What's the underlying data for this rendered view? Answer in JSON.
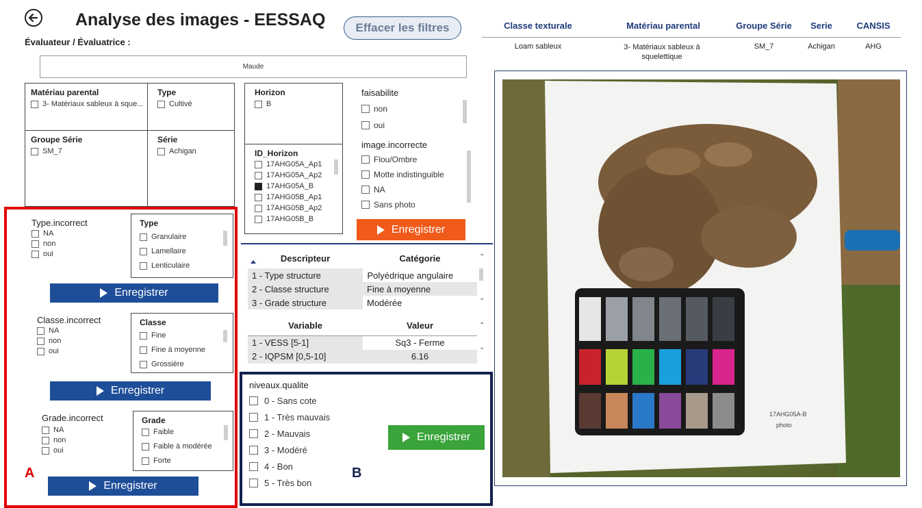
{
  "header": {
    "title": "Analyse des images - EESSAQ",
    "clear_filters": "Effacer les filtres",
    "evaluator_label": "Évaluateur / Évaluatrice :",
    "evaluator_value": "Maude"
  },
  "info_table": {
    "headers": [
      "Classe texturale",
      "Matériau parental",
      "Groupe Série",
      "Serie",
      "CANSIS"
    ],
    "values": [
      "Loam sableux",
      "3- Matériaux sableux à squelettique",
      "SM_7",
      "Achigan",
      "AHG"
    ]
  },
  "filters": {
    "materiau": {
      "title": "Matériau parental",
      "items": [
        "3- Matériaux sableux à sque..."
      ]
    },
    "type": {
      "title": "Type",
      "items": [
        "Cultivé"
      ]
    },
    "groupe": {
      "title": "Groupe Série",
      "items": [
        "SM_7"
      ]
    },
    "serie": {
      "title": "Série",
      "items": [
        "Achigan"
      ]
    },
    "horizon": {
      "title": "Horizon",
      "items": [
        "B"
      ]
    },
    "id_horizon": {
      "title": "ID_Horizon",
      "items": [
        "17AHG05A_Ap1",
        "17AHG05A_Ap2",
        "17AHG05A_B",
        "17AHG05B_Ap1",
        "17AHG05B_Ap2",
        "17AHG05B_B"
      ],
      "checked_index": 2
    },
    "faisabilite": {
      "title": "faisabilite",
      "items": [
        "non",
        "oui"
      ]
    },
    "image_incorrecte": {
      "title": "image.incorrecte",
      "items": [
        "Flou/Ombre",
        "Motte indistinguible",
        "NA",
        "Sans photo"
      ]
    }
  },
  "section_a": {
    "label": "A",
    "type_incorrect": {
      "title": "Type.incorrect",
      "items": [
        "NA",
        "non",
        "oui"
      ]
    },
    "type_choice": {
      "title": "Type",
      "items": [
        "Granulaire",
        "Lamellaire",
        "Lenticulaire"
      ]
    },
    "classe_incorrect": {
      "title": "Classe.incorrect",
      "items": [
        "NA",
        "non",
        "oui"
      ]
    },
    "classe_choice": {
      "title": "Classe",
      "items": [
        "Fine",
        "Fine à moyenne",
        "Grossière"
      ]
    },
    "grade_incorrect": {
      "title": "Grade.incorrect",
      "items": [
        "NA",
        "non",
        "oui"
      ]
    },
    "grade_choice": {
      "title": "Grade",
      "items": [
        "Faible",
        "Faible à modérée",
        "Forte"
      ]
    }
  },
  "buttons": {
    "save": "Enregistrer"
  },
  "descriptor_table": {
    "headers": [
      "Descripteur",
      "Catégorie"
    ],
    "rows": [
      [
        "1 - Type structure",
        "Polyédrique angulaire"
      ],
      [
        "2 - Classe structure",
        "Fine à moyenne"
      ],
      [
        "3 - Grade structure",
        "Modérée"
      ]
    ]
  },
  "variable_table": {
    "headers": [
      "Variable",
      "Valeur"
    ],
    "rows": [
      [
        "1 - VESS [5-1]",
        "Sq3 - Ferme"
      ],
      [
        "2 - IQPSM [0,5-10]",
        "6.16"
      ]
    ]
  },
  "section_b": {
    "label": "B",
    "title": "niveaux.qualite",
    "items": [
      "0 - Sans cote",
      "1 - Très mauvais",
      "2 - Mauvais",
      "3 - Modéré",
      "4 - Bon",
      "5 - Très bon"
    ]
  },
  "photo": {
    "sample_label": "17AHG05A-B",
    "sample_sub": "photo",
    "colors": {
      "gray_row": [
        "#e6e6e6",
        "#9aa0a6",
        "#80868c",
        "#6a7076",
        "#555a60",
        "#3a3e44"
      ],
      "mid_row": [
        "#c8232c",
        "#b5d334",
        "#2ab24a",
        "#1aa0dc",
        "#273a7a",
        "#d8258d"
      ],
      "bottom_row": [
        "#5a3a33",
        "#c8875b",
        "#2a78c8",
        "#8a4a9a",
        "#a89a8a",
        "#8c8c8c"
      ]
    }
  },
  "colors": {
    "red_highlight": "#e00000",
    "navy_highlight": "#13214f",
    "accent_blue": "#1f4e99"
  }
}
